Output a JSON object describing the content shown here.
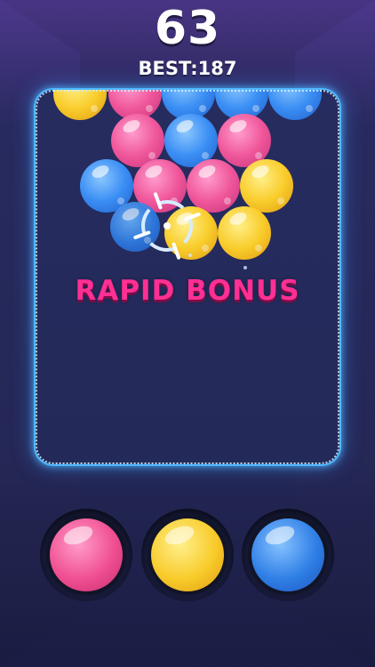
{
  "hud": {
    "score": "63",
    "best": "BEST:187"
  },
  "board": {
    "bonus_text": "RAPID BONUS",
    "bubbles": [
      {
        "color": "yellow"
      },
      {
        "color": "pink"
      },
      {
        "color": "blue"
      },
      {
        "color": "blue"
      },
      {
        "color": "blue"
      },
      {
        "color": "pink"
      },
      {
        "color": "blue"
      },
      {
        "color": "pink"
      },
      {
        "color": "blue"
      },
      {
        "color": "pink"
      },
      {
        "color": "pink"
      },
      {
        "color": "yellow"
      },
      {
        "color": "yellow"
      },
      {
        "color": "yellow"
      }
    ],
    "shooter_color": "blue",
    "aim_icon": "crosshair-icon"
  },
  "color_selector": {
    "options": [
      "pink",
      "yellow",
      "blue"
    ]
  },
  "colors": {
    "background": "#232654",
    "board_border": "#50b8ff",
    "bonus_text": "#ff2f93",
    "pink": "#f0579b",
    "yellow": "#f9cd2c",
    "blue": "#3a8ef4"
  }
}
